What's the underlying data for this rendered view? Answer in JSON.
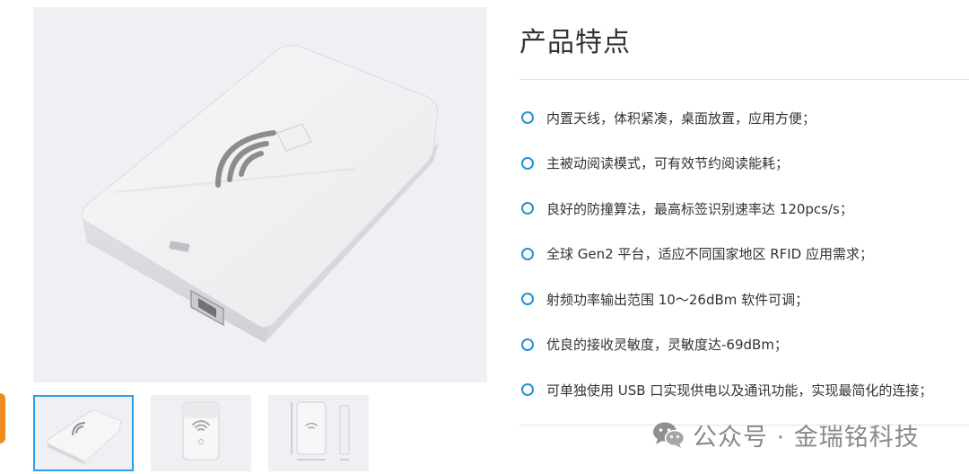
{
  "product": {
    "main_image_icon": "rfid-reader-device-image",
    "thumbnails": [
      {
        "icon": "rfid-reader-angled-thumbnail",
        "active": true
      },
      {
        "icon": "rfid-reader-front-thumbnail",
        "active": false
      },
      {
        "icon": "rfid-reader-dimensions-thumbnail",
        "active": false
      }
    ]
  },
  "features_section": {
    "title": "产品特点",
    "items": [
      "内置天线，体积紧凑，桌面放置，应用方便；",
      "主被动阅读模式，可有效节约阅读能耗；",
      "良好的防撞算法，最高标签识别速率达 120pcs/s；",
      "全球 Gen2 平台，适应不同国家地区 RFID 应用需求；",
      "射频功率输出范围 10～26dBm 软件可调；",
      "优良的接收灵敏度，灵敏度达-69dBm；",
      "可单独使用 USB 口实现供电以及通讯功能，实现最简化的连接；"
    ],
    "bullet_color": "#2391d6"
  },
  "watermark": {
    "icon": "wechat-icon",
    "text": "公众号 · 金瑞铭科技"
  },
  "colors": {
    "accent": "#2d9ee8",
    "side_tab": "#f08a1e"
  }
}
